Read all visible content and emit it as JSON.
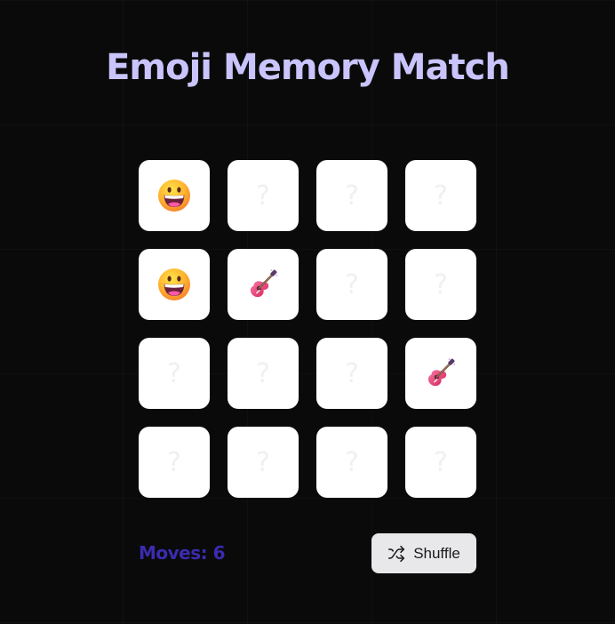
{
  "title": "Emoji Memory Match",
  "colors": {
    "background": "#0a0a0a",
    "title": "#c9c4fb",
    "card": "#ffffff",
    "hidden_glyph": "#f0f0f2",
    "moves_text": "#3b2bb0",
    "button_bg": "#e8e8ea"
  },
  "board": {
    "hidden_symbol": "?",
    "cards": [
      {
        "state": "revealed",
        "emoji": "grinning-face"
      },
      {
        "state": "hidden"
      },
      {
        "state": "hidden"
      },
      {
        "state": "hidden"
      },
      {
        "state": "revealed",
        "emoji": "grinning-face"
      },
      {
        "state": "revealed",
        "emoji": "guitar"
      },
      {
        "state": "hidden"
      },
      {
        "state": "hidden"
      },
      {
        "state": "hidden"
      },
      {
        "state": "hidden"
      },
      {
        "state": "hidden"
      },
      {
        "state": "revealed",
        "emoji": "guitar"
      },
      {
        "state": "hidden"
      },
      {
        "state": "hidden"
      },
      {
        "state": "hidden"
      },
      {
        "state": "hidden"
      }
    ]
  },
  "stats": {
    "moves_label": "Moves: 6"
  },
  "controls": {
    "shuffle_label": "Shuffle",
    "shuffle_icon": "shuffle-icon"
  }
}
